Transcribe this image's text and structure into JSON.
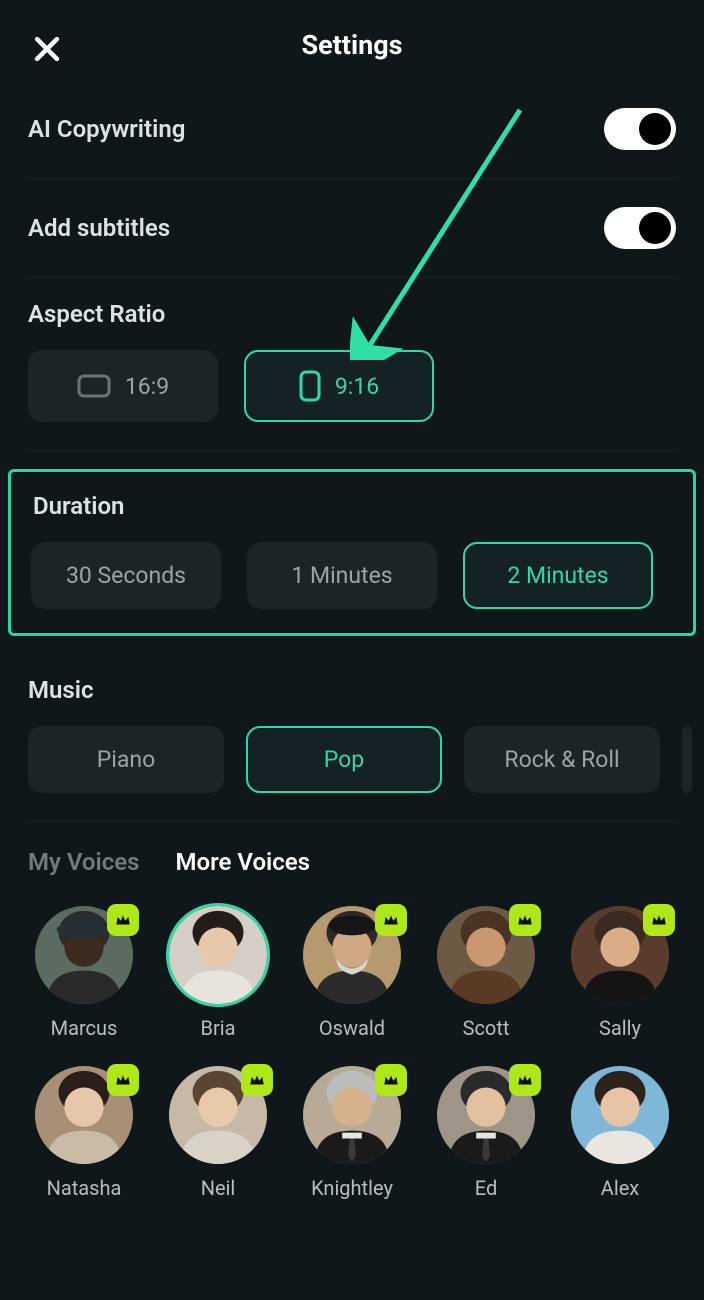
{
  "header": {
    "title": "Settings"
  },
  "toggles": {
    "ai_copy": {
      "label": "AI Copywriting",
      "on": true
    },
    "subtitles": {
      "label": "Add subtitles",
      "on": true
    }
  },
  "aspect": {
    "title": "Aspect Ratio",
    "options": [
      "16:9",
      "9:16"
    ],
    "selected": 1
  },
  "duration": {
    "title": "Duration",
    "options": [
      "30 Seconds",
      "1 Minutes",
      "2 Minutes"
    ],
    "selected": 2
  },
  "music": {
    "title": "Music",
    "options": [
      "Piano",
      "Pop",
      "Rock & Roll"
    ],
    "selected": 1
  },
  "voice_tabs": {
    "items": [
      "My Voices",
      "More Voices"
    ],
    "active": 1
  },
  "voices": [
    {
      "name": "Marcus",
      "premium": true,
      "selected": false,
      "bg": "#5b6b60",
      "skin": "#3b2a1e",
      "shirt": "#2a2a2a",
      "hat": true
    },
    {
      "name": "Bria",
      "premium": false,
      "selected": true,
      "bg": "#d5cfc7",
      "skin": "#e7c8ad",
      "shirt": "#e8e3dc",
      "hair": "#231c18"
    },
    {
      "name": "Oswald",
      "premium": true,
      "selected": false,
      "bg": "#b49a6e",
      "skin": "#cfa882",
      "shirt": "#2b2b2b",
      "beret": true,
      "beard": true
    },
    {
      "name": "Scott",
      "premium": true,
      "selected": false,
      "bg": "#6b5a44",
      "skin": "#c99870",
      "shirt": "#5a3a24",
      "hair": "#4a3322"
    },
    {
      "name": "Sally",
      "premium": true,
      "selected": false,
      "bg": "#5a3c2e",
      "skin": "#d8ad88",
      "shirt": "#141414",
      "hair": "#3a2a20"
    },
    {
      "name": "Natasha",
      "premium": true,
      "selected": false,
      "bg": "#a88f78",
      "skin": "#e6c7a9",
      "shirt": "#c8bca8",
      "hair": "#2a1f18"
    },
    {
      "name": "Neil",
      "premium": true,
      "selected": false,
      "bg": "#c7b9a7",
      "skin": "#e8caab",
      "shirt": "#dad2c6",
      "hair": "#5a4432"
    },
    {
      "name": "Knightley",
      "premium": true,
      "selected": false,
      "bg": "#b7ab98",
      "skin": "#d6b28c",
      "shirt": "#1a1a1a",
      "tie": true,
      "gray": true
    },
    {
      "name": "Ed",
      "premium": true,
      "selected": false,
      "bg": "#9e9588",
      "skin": "#e1c1a0",
      "shirt": "#1a1a1a",
      "tie": true,
      "hair": "#2a2a2a"
    },
    {
      "name": "Alex",
      "premium": false,
      "selected": false,
      "bg": "#7fb7d6",
      "skin": "#e6c4a5",
      "shirt": "#eae6df",
      "hair": "#2e231c"
    }
  ],
  "accent": "#30D9A4"
}
